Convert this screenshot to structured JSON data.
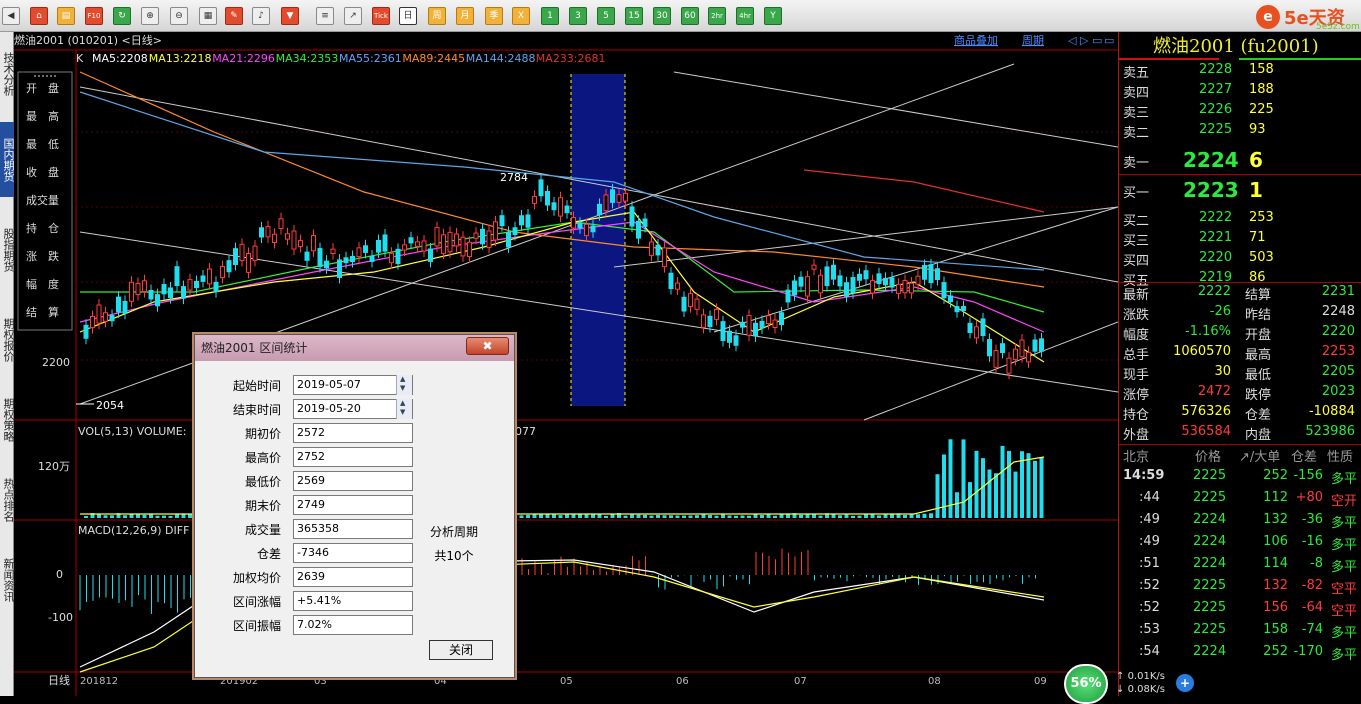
{
  "toolbar": {
    "items": [
      {
        "name": "back-icon",
        "glyph": "◀",
        "cls": ""
      },
      {
        "name": "home-icon",
        "glyph": "⌂",
        "cls": "r"
      },
      {
        "name": "notebook-icon",
        "glyph": "▤",
        "cls": "o"
      },
      {
        "name": "f10-icon",
        "glyph": "F10",
        "cls": "r"
      },
      {
        "name": "refresh-icon",
        "glyph": "↻",
        "cls": "g"
      },
      {
        "name": "zoom-in-icon",
        "glyph": "⊕",
        "cls": ""
      },
      {
        "name": "zoom-out-icon",
        "glyph": "⊖",
        "cls": ""
      },
      {
        "name": "window-icon",
        "glyph": "▦",
        "cls": ""
      },
      {
        "name": "pen-icon",
        "glyph": "✎",
        "cls": "r"
      },
      {
        "name": "brush-icon",
        "glyph": "♪",
        "cls": ""
      },
      {
        "name": "filter-icon",
        "glyph": "▼",
        "cls": "r"
      },
      {
        "name": "list-icon",
        "glyph": "≡",
        "cls": ""
      },
      {
        "name": "chart-icon",
        "glyph": "↗",
        "cls": ""
      },
      {
        "name": "tick-icon",
        "glyph": "Tick",
        "cls": "r"
      },
      {
        "name": "period-day",
        "glyph": "日",
        "cls": "sel"
      },
      {
        "name": "period-week",
        "glyph": "周",
        "cls": "o"
      },
      {
        "name": "period-month",
        "glyph": "月",
        "cls": "o"
      },
      {
        "name": "period-season",
        "glyph": "季",
        "cls": "o"
      },
      {
        "name": "period-year",
        "glyph": "X",
        "cls": "o"
      },
      {
        "name": "period-1min",
        "glyph": "1",
        "cls": "g"
      },
      {
        "name": "period-3min",
        "glyph": "3",
        "cls": "g"
      },
      {
        "name": "period-5min",
        "glyph": "5",
        "cls": "g"
      },
      {
        "name": "period-15min",
        "glyph": "15",
        "cls": "g"
      },
      {
        "name": "period-30min",
        "glyph": "30",
        "cls": "g"
      },
      {
        "name": "period-60min",
        "glyph": "60",
        "cls": "g"
      },
      {
        "name": "period-2hr",
        "glyph": "2hr",
        "cls": "g"
      },
      {
        "name": "period-4hr",
        "glyph": "4hr",
        "cls": "g"
      },
      {
        "name": "period-y",
        "glyph": "Y",
        "cls": "g"
      }
    ],
    "logo": "5e天资",
    "logo_circle": "e",
    "logo_url": "5e5z.com"
  },
  "leftbar": [
    "技术分析",
    "国内期货",
    "股指期货",
    "期权报价",
    "期权策略",
    "热点排名",
    "新闻资讯"
  ],
  "chart": {
    "title": "燃油2001 (010201) <日线>",
    "links": [
      "商品叠加",
      "周期"
    ],
    "ma_prefix": "K",
    "ma": [
      {
        "label": "MA5:2208",
        "color": "#ffffff"
      },
      {
        "label": "MA13:2218",
        "color": "#ffff33"
      },
      {
        "label": "MA21:2296",
        "color": "#ff44ff"
      },
      {
        "label": "MA34:2353",
        "color": "#33ee33"
      },
      {
        "label": "MA55:2361",
        "color": "#6aa0ff"
      },
      {
        "label": "MA89:2445",
        "color": "#ff8a2a"
      },
      {
        "label": "MA144:2488",
        "color": "#5aa6e8"
      },
      {
        "label": "MA233:2681",
        "color": "#e03030"
      }
    ],
    "side_menu": [
      "开　盘",
      "最　高",
      "最　低",
      "收　盘",
      "成交量",
      "持　仓",
      "涨　跌",
      "幅　度",
      "结　算"
    ],
    "price_label": "2200",
    "high_mark": "2784",
    "low_mark": "2054",
    "vol_title": "VOL(5,13) VOLUME:",
    "vol_value": "3077",
    "vol_axis": "120万",
    "macd_title": "MACD(12,26,9) DIFF",
    "macd_axis": [
      "0",
      "-100"
    ],
    "bottom_label": "日线",
    "dates": [
      "201812",
      "201902",
      "03",
      "04",
      "05",
      "06",
      "07",
      "08",
      "09"
    ]
  },
  "dialog": {
    "title": "燃油2001 区间统计",
    "close_x": "✖",
    "fields": [
      {
        "label": "起始时间",
        "value": "2019-05-07",
        "spin": true
      },
      {
        "label": "结束时间",
        "value": "2019-05-20",
        "spin": true
      },
      {
        "label": "期初价",
        "value": "2572"
      },
      {
        "label": "最高价",
        "value": "2752"
      },
      {
        "label": "最低价",
        "value": "2569"
      },
      {
        "label": "期末价",
        "value": "2749"
      },
      {
        "label": "成交量",
        "value": "365358"
      },
      {
        "label": "仓差",
        "value": "-7346"
      },
      {
        "label": "加权均价",
        "value": "2639"
      },
      {
        "label": "区间涨幅",
        "value": "+5.41%"
      },
      {
        "label": "区间振幅",
        "value": "7.02%"
      }
    ],
    "period_label": "分析周期",
    "period_value": "共10个",
    "button": "关闭"
  },
  "quote": {
    "title": "燃油2001 (fu2001)",
    "asks": [
      {
        "l": "卖五",
        "p": "2228",
        "v": "158"
      },
      {
        "l": "卖四",
        "p": "2227",
        "v": "188"
      },
      {
        "l": "卖三",
        "p": "2226",
        "v": "225"
      },
      {
        "l": "卖二",
        "p": "2225",
        "v": "93"
      },
      {
        "l": "卖一",
        "p": "2224",
        "v": "6"
      }
    ],
    "bids": [
      {
        "l": "买一",
        "p": "2223",
        "v": "1"
      },
      {
        "l": "买二",
        "p": "2222",
        "v": "253"
      },
      {
        "l": "买三",
        "p": "2221",
        "v": "71"
      },
      {
        "l": "买四",
        "p": "2220",
        "v": "503"
      },
      {
        "l": "买五",
        "p": "2219",
        "v": "86"
      }
    ],
    "stats": [
      {
        "l1": "最新",
        "v1": "2222",
        "c1": "grn",
        "l2": "结算",
        "v2": "2231",
        "c2": "grn"
      },
      {
        "l1": "涨跌",
        "v1": "-26",
        "c1": "grn",
        "l2": "昨结",
        "v2": "2248",
        "c2": "wht"
      },
      {
        "l1": "幅度",
        "v1": "-1.16%",
        "c1": "grn",
        "l2": "开盘",
        "v2": "2220",
        "c2": "grn"
      },
      {
        "l1": "总手",
        "v1": "1060570",
        "c1": "yel",
        "l2": "最高",
        "v2": "2253",
        "c2": "red"
      },
      {
        "l1": "现手",
        "v1": "30",
        "c1": "yel",
        "l2": "最低",
        "v2": "2205",
        "c2": "grn"
      },
      {
        "l1": "涨停",
        "v1": "2472",
        "c1": "red",
        "l2": "跌停",
        "v2": "2023",
        "c2": "grn"
      },
      {
        "l1": "持仓",
        "v1": "576326",
        "c1": "yel",
        "l2": "仓差",
        "v2": "-10884",
        "c2": "yel"
      },
      {
        "l1": "外盘",
        "v1": "536584",
        "c1": "red",
        "l2": "内盘",
        "v2": "523986",
        "c2": "grn"
      }
    ],
    "tick_header": [
      "北京",
      "价格",
      "↗/大单",
      "仓差",
      "性质"
    ],
    "ticks": [
      {
        "t": "14:59",
        "p": "2225",
        "pc": "grn",
        "v": "252",
        "d": "-156",
        "n": "多平",
        "nc": "grn"
      },
      {
        "t": ":44",
        "p": "2225",
        "pc": "grn",
        "v": "112",
        "d": "+80",
        "n": "空开",
        "nc": "red"
      },
      {
        "t": ":49",
        "p": "2224",
        "pc": "grn",
        "v": "132",
        "d": "-36",
        "n": "多平",
        "nc": "grn"
      },
      {
        "t": ":49",
        "p": "2224",
        "pc": "grn",
        "v": "106",
        "d": "-16",
        "n": "多平",
        "nc": "grn"
      },
      {
        "t": ":51",
        "p": "2224",
        "pc": "grn",
        "v": "114",
        "d": "-8",
        "n": "多平",
        "nc": "grn"
      },
      {
        "t": ":52",
        "p": "2225",
        "pc": "grn",
        "v": "132",
        "vc": "red",
        "d": "-82",
        "n": "空平",
        "nc": "red"
      },
      {
        "t": ":52",
        "p": "2225",
        "pc": "grn",
        "v": "156",
        "vc": "red",
        "d": "-64",
        "n": "空平",
        "nc": "red"
      },
      {
        "t": ":53",
        "p": "2225",
        "pc": "grn",
        "v": "158",
        "d": "-74",
        "n": "多平",
        "nc": "grn"
      },
      {
        "t": ":54",
        "p": "2224",
        "pc": "grn",
        "v": "252",
        "d": "-170",
        "n": "多平",
        "nc": "grn"
      }
    ]
  },
  "status": {
    "cpu": "56%",
    "up": "0.01K/s",
    "down": "0.08K/s"
  }
}
